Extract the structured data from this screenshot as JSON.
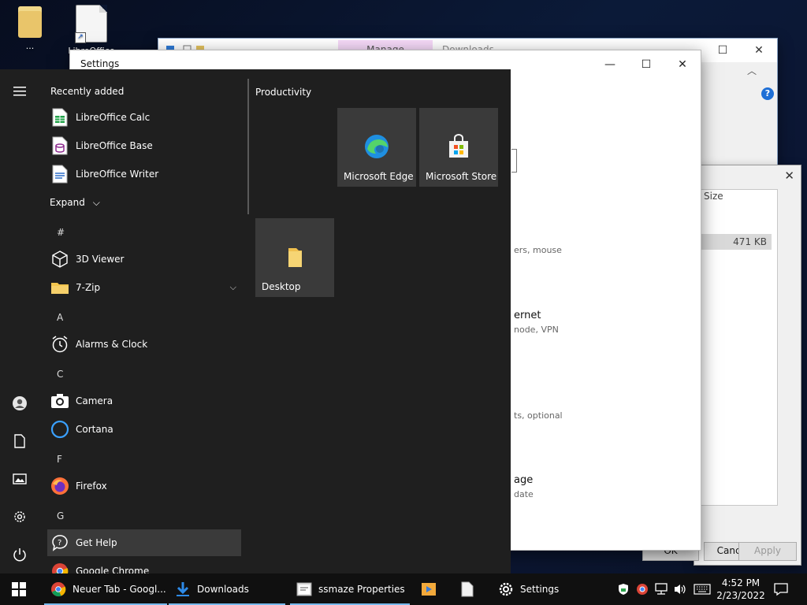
{
  "desktop": {
    "icons": [
      {
        "label": "..."
      },
      {
        "label": "LibreOffice"
      }
    ]
  },
  "explorer": {
    "manage_tab": "Manage",
    "title": "Downloads"
  },
  "properties": {
    "size_header": "Size",
    "size_value": "471 KB",
    "ok": "OK",
    "cancel": "Cancel",
    "apply": "Apply"
  },
  "settings": {
    "title": "Settings",
    "categories": [
      {
        "title": "",
        "desc": "ers, mouse"
      },
      {
        "title": "ernet",
        "desc": "node, VPN"
      },
      {
        "title": "",
        "desc": "ts, optional"
      },
      {
        "title": "age",
        "desc": "date"
      }
    ]
  },
  "start_menu": {
    "recently_added": "Recently added",
    "expand": "Expand",
    "productivity": "Productivity",
    "recent_apps": [
      "LibreOffice Calc",
      "LibreOffice Base",
      "LibreOffice Writer"
    ],
    "groups": [
      {
        "letter": "#",
        "apps": [
          "3D Viewer",
          "7-Zip"
        ]
      },
      {
        "letter": "A",
        "apps": [
          "Alarms & Clock"
        ]
      },
      {
        "letter": "C",
        "apps": [
          "Camera",
          "Cortana"
        ]
      },
      {
        "letter": "F",
        "apps": [
          "Firefox"
        ]
      },
      {
        "letter": "G",
        "apps": [
          "Get Help",
          "Google Chrome"
        ]
      }
    ],
    "tiles": [
      "Microsoft Edge",
      "Microsoft Store",
      "Desktop"
    ]
  },
  "taskbar": {
    "items": [
      "Neuer Tab - Googl...",
      "Downloads",
      "ssmaze Properties",
      "Settings"
    ],
    "time": "4:52 PM",
    "date": "2/23/2022"
  },
  "colors": {
    "start_bg": "#1f1f1f",
    "tile_bg": "#3a3a3a",
    "taskbar_bg": "#101010",
    "accent": "#76b9ed"
  }
}
